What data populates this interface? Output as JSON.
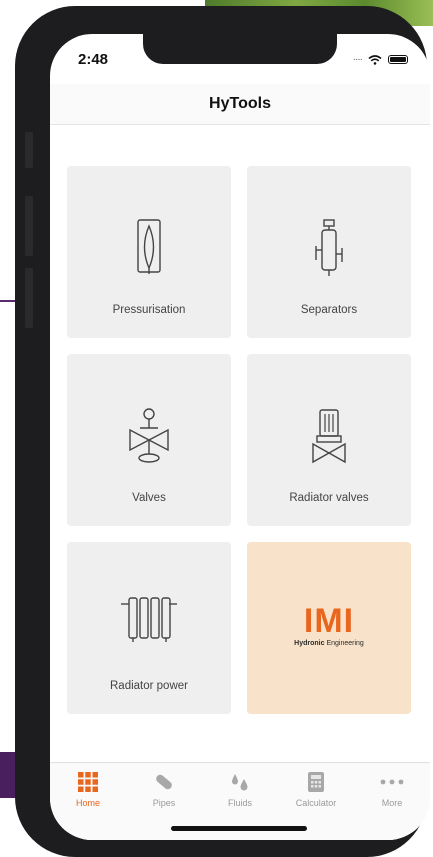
{
  "status_bar": {
    "time": "2:48"
  },
  "navbar": {
    "title": "HyTools"
  },
  "tiles": [
    {
      "label": "Pressurisation",
      "icon": "pressurisation-vessel-icon"
    },
    {
      "label": "Separators",
      "icon": "separator-icon"
    },
    {
      "label": "Valves",
      "icon": "valve-icon"
    },
    {
      "label": "Radiator valves",
      "icon": "radiator-valve-icon"
    },
    {
      "label": "Radiator power",
      "icon": "radiator-icon"
    }
  ],
  "brand_tile": {
    "logo_text": "IMI",
    "tagline_bold": "Hydronic",
    "tagline_rest": " Engineering"
  },
  "tabs": [
    {
      "label": "Home",
      "icon": "grid-icon",
      "active": true
    },
    {
      "label": "Pipes",
      "icon": "pipe-icon"
    },
    {
      "label": "Fluids",
      "icon": "droplets-icon"
    },
    {
      "label": "Calculator",
      "icon": "calculator-icon"
    },
    {
      "label": "More",
      "icon": "more-dots-icon"
    }
  ],
  "colors": {
    "accent": "#e8661e",
    "tile_bg": "#efefef",
    "brand_tile_bg": "#f8e2c9"
  }
}
